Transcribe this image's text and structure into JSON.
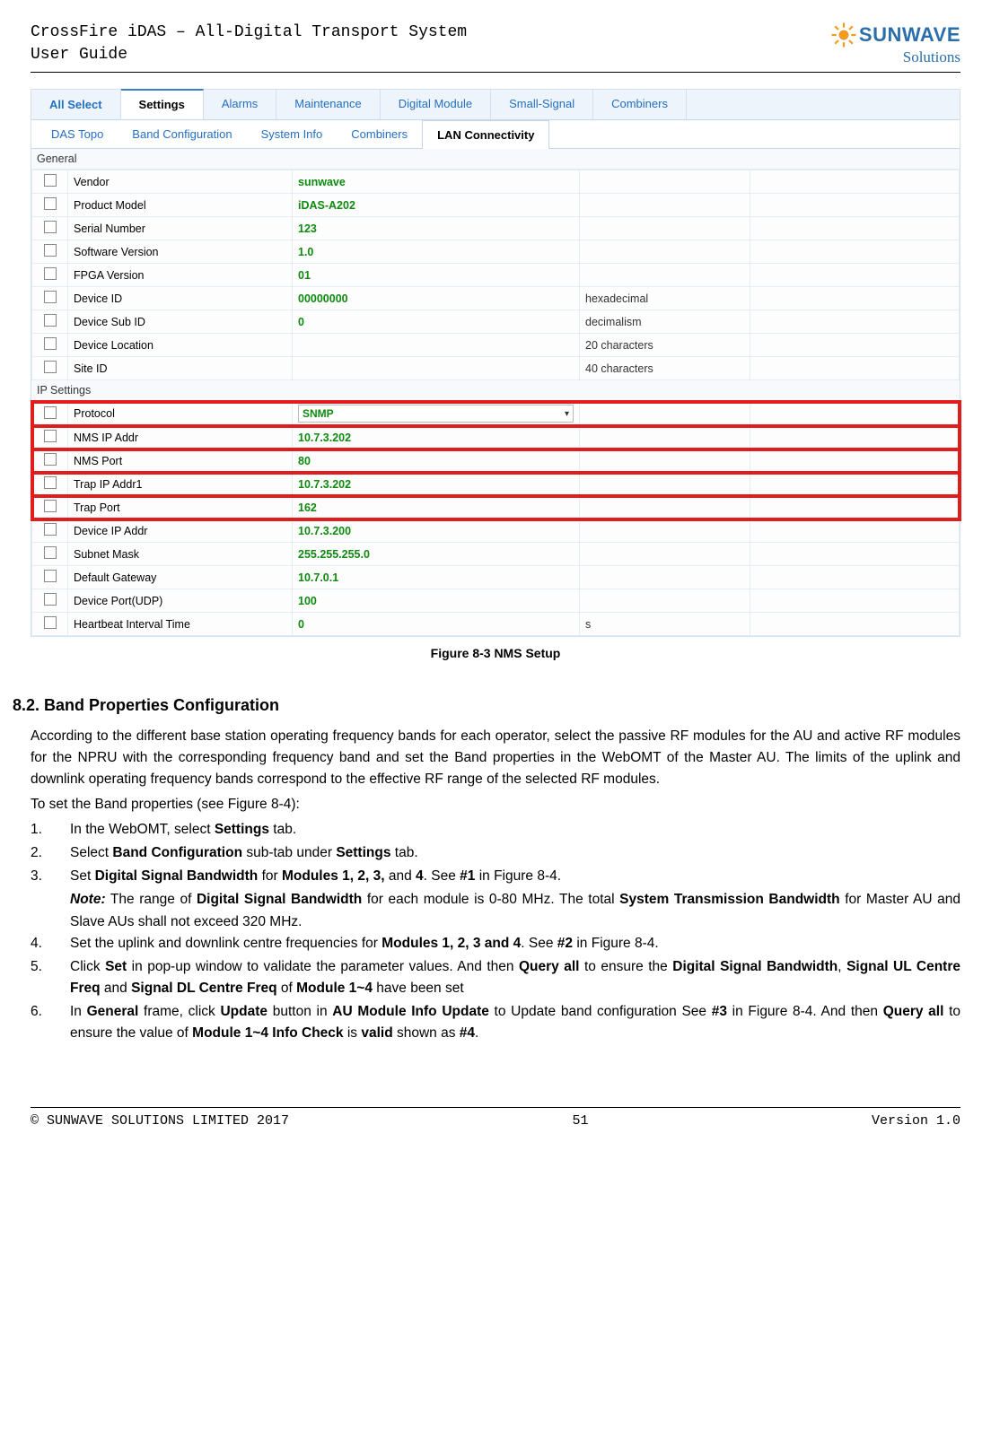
{
  "header": {
    "title": "CrossFire iDAS – All-Digital Transport System",
    "subtitle": "User Guide",
    "logo_main": "SUNWAVE",
    "logo_sub": "Solutions"
  },
  "screenshot": {
    "main_tabs": [
      "All Select",
      "Settings",
      "Alarms",
      "Maintenance",
      "Digital Module",
      "Small-Signal",
      "Combiners"
    ],
    "main_active": "Settings",
    "sub_tabs": [
      "DAS Topo",
      "Band Configuration",
      "System Info",
      "Combiners",
      "LAN Connectivity"
    ],
    "sub_active": "LAN Connectivity",
    "sections": [
      {
        "title": "General",
        "rows": [
          {
            "label": "Vendor",
            "value": "sunwave",
            "unit": ""
          },
          {
            "label": "Product Model",
            "value": "iDAS-A202",
            "unit": ""
          },
          {
            "label": "Serial Number",
            "value": "123",
            "unit": ""
          },
          {
            "label": "Software Version",
            "value": "1.0",
            "unit": ""
          },
          {
            "label": "FPGA Version",
            "value": "01",
            "unit": ""
          },
          {
            "label": "Device ID",
            "value": "00000000",
            "unit": "hexadecimal"
          },
          {
            "label": "Device Sub ID",
            "value": "0",
            "unit": "decimalism"
          },
          {
            "label": "Device Location",
            "value": "",
            "unit": "20 characters"
          },
          {
            "label": "Site ID",
            "value": "",
            "unit": "40 characters"
          }
        ]
      },
      {
        "title": "IP Settings",
        "rows": [
          {
            "label": "Protocol",
            "value": "SNMP",
            "dropdown": true,
            "hl": true
          },
          {
            "label": "NMS IP Addr",
            "value": "10.7.3.202",
            "hl": true
          },
          {
            "label": "NMS Port",
            "value": "80",
            "hl": true
          },
          {
            "label": "Trap IP Addr1",
            "value": "10.7.3.202",
            "hl": true
          },
          {
            "label": "Trap Port",
            "value": "162",
            "hl": true
          },
          {
            "label": "Device IP Addr",
            "value": "10.7.3.200"
          },
          {
            "label": "Subnet Mask",
            "value": "255.255.255.0"
          },
          {
            "label": "Default Gateway",
            "value": "10.7.0.1"
          },
          {
            "label": "Device Port(UDP)",
            "value": "100"
          },
          {
            "label": "Heartbeat Interval Time",
            "value": "0",
            "unit": "s"
          }
        ]
      }
    ]
  },
  "caption": "Figure 8-3 NMS Setup",
  "section": {
    "heading": "8.2. Band Properties Configuration",
    "para1": "According to the different base station operating frequency bands for each operator, select the passive RF modules for the AU and active RF modules for the NPRU with the corresponding frequency band and set the Band properties in the WebOMT of the Master AU. The limits of the uplink and downlink operating frequency bands correspond to the effective RF range of the selected RF modules.",
    "para2": "To set the Band properties (see Figure 8-4):",
    "items": {
      "i1_pre": "In the WebOMT, select ",
      "i1_b1": "Settings",
      "i1_post": " tab.",
      "i2_pre": "Select ",
      "i2_b1": "Band Configuration",
      "i2_mid": " sub-tab under ",
      "i2_b2": "Settings",
      "i2_post": " tab.",
      "i3_pre": "Set ",
      "i3_b1": "Digital Signal Bandwidth",
      "i3_mid1": " for ",
      "i3_b2": "Modules 1, 2, 3,",
      "i3_mid2": " and ",
      "i3_b3": "4",
      "i3_mid3": ". See ",
      "i3_b4": "#1",
      "i3_post": " in Figure 8-4.",
      "i3n_b1": "Note:",
      "i3n_t1": " The range of ",
      "i3n_b2": "Digital Signal Bandwidth",
      "i3n_t2": " for each module is 0-80 MHz. The total ",
      "i3n_b3": "System Transmission Bandwidth",
      "i3n_t3": " for Master AU and Slave AUs shall not exceed 320 MHz.",
      "i4_pre": "Set the uplink and downlink centre frequencies for ",
      "i4_b1": "Modules 1, 2, 3 and 4",
      "i4_mid": ". See ",
      "i4_b2": "#2",
      "i4_post": " in Figure 8-4.",
      "i5_pre": "Click ",
      "i5_b1": "Set",
      "i5_t1": " in pop-up window to validate the parameter values. And then ",
      "i5_b2": "Query all",
      "i5_t2": " to ensure the ",
      "i5_b3": "Digital Signal Bandwidth",
      "i5_t3": ", ",
      "i5_b4": "Signal UL Centre Freq",
      "i5_t4": " and ",
      "i5_b5": "Signal DL Centre Freq",
      "i5_t5": " of ",
      "i5_b6": "Module 1~4",
      "i5_t6": " have been set",
      "i6_pre": "In ",
      "i6_b1": "General",
      "i6_t1": " frame, click ",
      "i6_b2": "Update",
      "i6_t2": " button in ",
      "i6_b3": "AU Module Info Update",
      "i6_t3": " to Update band configuration See ",
      "i6_b4": "#3",
      "i6_t4": " in Figure 8-4. And then ",
      "i6_b5": "Query all",
      "i6_t5": " to ensure the value of ",
      "i6_b6": "Module 1~4 Info Check",
      "i6_t6": " is ",
      "i6_b7": "valid",
      "i6_t7": " shown as ",
      "i6_b8": "#4",
      "i6_t8": "."
    },
    "nums": [
      "1.",
      "2.",
      "3.",
      "4.",
      "5.",
      "6."
    ]
  },
  "footer": {
    "left": "© SUNWAVE SOLUTIONS LIMITED 2017",
    "center": "51",
    "right": "Version 1.0"
  }
}
